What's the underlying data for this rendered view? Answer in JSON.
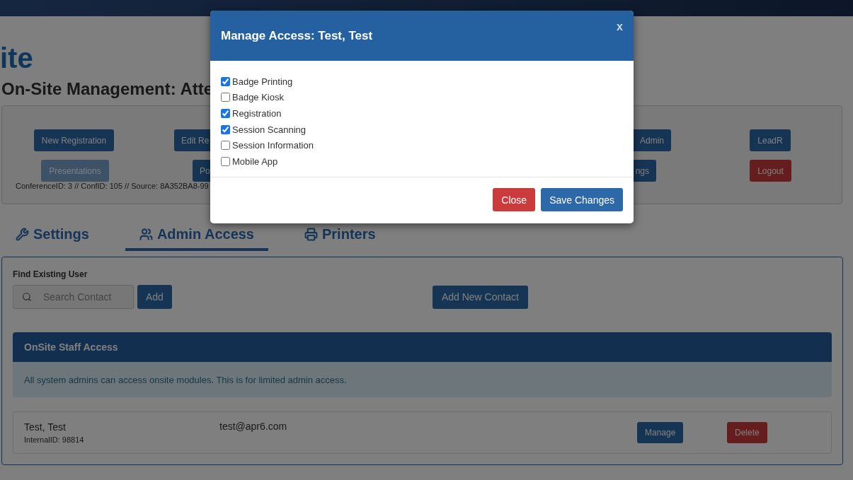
{
  "app_title": "ite",
  "page_heading": "On-Site Management: Atte",
  "nav_rows": [
    [
      {
        "label": "New Registration",
        "kind": "primary"
      },
      {
        "label": "Edit Re",
        "kind": "primary"
      },
      {
        "label": "Admin",
        "kind": "primary"
      },
      {
        "label": "LeadR",
        "kind": "primary"
      }
    ],
    [
      {
        "label": "Presentations",
        "kind": "muted"
      },
      {
        "label": "Po",
        "kind": "primary"
      },
      {
        "label": "ngs",
        "kind": "primary"
      },
      {
        "label": "Logout",
        "kind": "danger"
      }
    ]
  ],
  "info_line": "ConferenceID: 3 // ConfID: 105 // Source: 8A352BA8-99",
  "tabs": [
    {
      "label": "Settings",
      "selected": false
    },
    {
      "label": "Admin Access",
      "selected": true
    },
    {
      "label": "Printers",
      "selected": false
    }
  ],
  "find_user": {
    "label": "Find Existing User",
    "placeholder": "Search Contact",
    "add_button": "Add",
    "new_contact_button": "Add New Contact"
  },
  "staff_panel": {
    "title": "OnSite Staff Access",
    "note": "All system admins can access onsite modules. This is for limited admin access."
  },
  "staff": [
    {
      "name": "Test, Test",
      "internal_id": "InternalID: 98814",
      "email": "test@apr6.com",
      "manage": "Manage",
      "delete": "Delete"
    }
  ],
  "modal": {
    "title": "Manage Access: Test, Test",
    "close": "x",
    "modules": [
      {
        "label": "Badge Printing",
        "checked": true
      },
      {
        "label": "Badge Kiosk",
        "checked": false
      },
      {
        "label": "Registration",
        "checked": true
      },
      {
        "label": "Session Scanning",
        "checked": true
      },
      {
        "label": "Session Information",
        "checked": false
      },
      {
        "label": "Mobile App",
        "checked": false
      }
    ],
    "buttons": [
      {
        "label": "Close",
        "kind": "danger"
      },
      {
        "label": "Save Changes",
        "kind": "primary"
      }
    ]
  }
}
